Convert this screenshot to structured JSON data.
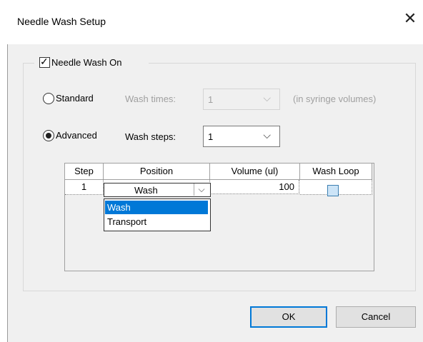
{
  "window": {
    "title": "Needle Wash Setup",
    "close_glyph": "✕"
  },
  "needle_wash": {
    "label": "Needle Wash On",
    "checked": true,
    "check_glyph": "✓"
  },
  "standard": {
    "label": "Standard",
    "selected": false,
    "wash_times_label": "Wash times:",
    "wash_times_value": "1",
    "units_label": "(in syringe volumes)"
  },
  "advanced": {
    "label": "Advanced",
    "selected": true,
    "wash_steps_label": "Wash steps:",
    "wash_steps_value": "1"
  },
  "dropdown_arrow": "⌵",
  "table": {
    "columns": [
      "Step",
      "Position",
      "Volume (ul)",
      "Wash Loop"
    ],
    "rows": [
      {
        "step": "1",
        "position": "Wash",
        "volume": "100",
        "wash_loop": false
      }
    ]
  },
  "position_dropdown": {
    "options": [
      "Wash",
      "Transport"
    ],
    "highlighted": "Wash"
  },
  "buttons": {
    "ok": "OK",
    "cancel": "Cancel"
  },
  "colors": {
    "accent": "#0078d7",
    "dialog_bg": "#f0f0f0",
    "disabled_text": "#a0a0a0"
  }
}
